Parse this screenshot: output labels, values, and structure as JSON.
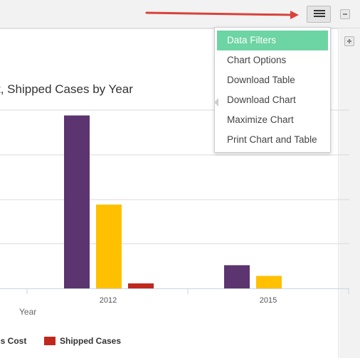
{
  "chart_title": "t, Shipped Cases by Year",
  "menu": {
    "items": [
      {
        "label": "Data Filters",
        "active": true
      },
      {
        "label": "Chart Options",
        "active": false
      },
      {
        "label": "Download Table",
        "active": false
      },
      {
        "label": "Download Chart",
        "active": false
      },
      {
        "label": "Maximize Chart",
        "active": false
      },
      {
        "label": "Print Chart and Table",
        "active": false
      }
    ]
  },
  "icons": {
    "menu_toggle": "hamburger-list-icon",
    "collapse": "minus-icon",
    "expand": "plus-icon",
    "annotation": "red-arrow-icon"
  },
  "colors": {
    "accent_active": "#6dd4a3",
    "annotation_arrow": "#d9423a"
  },
  "chart_data": {
    "type": "bar",
    "categories": [
      "2012",
      "2015"
    ],
    "xlabel": "Year",
    "ylabel": "",
    "ylim": [
      0,
      1
    ],
    "grid": true,
    "legend": "bottom",
    "legend_items": [
      "ss Cost",
      "Shipped Cases"
    ],
    "series": [
      {
        "name": "",
        "color": "#5c3470",
        "values": [
          0.97,
          0.13
        ]
      },
      {
        "name": "ss Cost",
        "color": "#ffc000",
        "values": [
          0.47,
          0.07
        ]
      },
      {
        "name": "Shipped Cases",
        "color": "#c0281e",
        "values": [
          0.028,
          0
        ]
      }
    ]
  }
}
